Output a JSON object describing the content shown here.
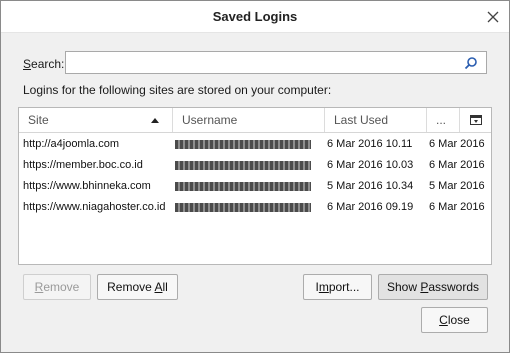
{
  "dialog": {
    "title": "Saved Logins"
  },
  "search": {
    "label_prefix": "",
    "label_underlined": "S",
    "label_rest": "earch:",
    "value": "",
    "placeholder": ""
  },
  "description": "Logins for the following sites are stored on your computer:",
  "table": {
    "columns": [
      "Site",
      "Username",
      "Last Used",
      "..."
    ],
    "sort": {
      "column": "Site",
      "direction": "ascending"
    },
    "rows": [
      {
        "site": "http://a4joomla.com",
        "last_used": "6 Mar 2016 10.11",
        "first_used": "6 Mar 2016"
      },
      {
        "site": "https://member.boc.co.id",
        "last_used": "6 Mar 2016 10.03",
        "first_used": "6 Mar 2016"
      },
      {
        "site": "https://www.bhinneka.com",
        "last_used": "5 Mar 2016 10.34",
        "first_used": "5 Mar 2016"
      },
      {
        "site": "https://www.niagahoster.co.id",
        "last_used": "6 Mar 2016 09.19",
        "first_used": "6 Mar 2016"
      }
    ]
  },
  "buttons": {
    "remove": {
      "u": "R",
      "rest": "emove",
      "enabled": false
    },
    "remove_all": {
      "pre": "Remove ",
      "u": "A",
      "rest": "ll"
    },
    "import": {
      "pre": "I",
      "u": "m",
      "rest": "port..."
    },
    "show_passwords": {
      "pre": "Show ",
      "u": "P",
      "rest": "asswords"
    },
    "close": {
      "u": "C",
      "rest": "lose"
    }
  },
  "icons": {
    "close": "close-icon",
    "search": "search-icon",
    "sort": "sort-ascending-icon",
    "column_picker": "column-picker-icon"
  }
}
